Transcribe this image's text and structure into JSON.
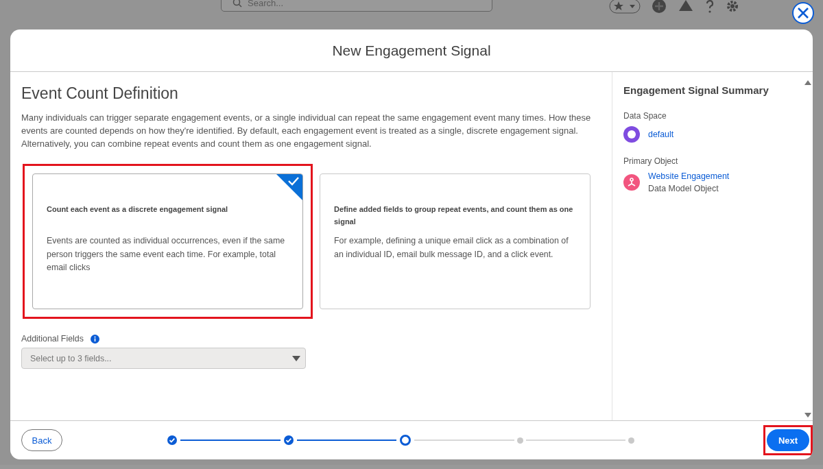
{
  "background": {
    "search": {
      "placeholder": "Search..."
    }
  },
  "dialog": {
    "title": "New Engagement Signal"
  },
  "section": {
    "heading": "Event Count Definition",
    "description": "Many individuals can trigger separate engagement events, or a single individual can repeat the same engagement event many times. How these events are counted depends on how they're identified. By default, each engagement event is treated as a single, discrete engagement signal. Alternatively, you can combine repeat events and count them as one engagement signal."
  },
  "options": [
    {
      "title": "Count each event as a discrete engagement signal",
      "description": "Events are counted as individual occurrences, even if the same person triggers the same event each time. For example, total email clicks",
      "selected": true,
      "highlighted": true
    },
    {
      "title": "Define added fields to group repeat events, and count them as one signal",
      "description": "For example, defining a unique email click as a combination of an individual ID, email bulk message ID, and a click event.",
      "selected": false,
      "highlighted": false
    }
  ],
  "additional_fields": {
    "label": "Additional Fields",
    "placeholder": "Select up to 3 fields..."
  },
  "summary": {
    "title": "Engagement Signal Summary",
    "items": [
      {
        "kind": "data-space",
        "label": "Data Space",
        "value": "default"
      },
      {
        "kind": "object",
        "label": "Primary Object",
        "value": "Website Engagement",
        "subtitle": "Data Model Object"
      }
    ]
  },
  "footer": {
    "back": "Back",
    "next": {
      "label": "Next",
      "highlighted": true
    },
    "steps": [
      {
        "kind": "complete"
      },
      {
        "kind": "complete"
      },
      {
        "kind": "current"
      },
      {
        "kind": "upcoming"
      },
      {
        "kind": "upcoming"
      }
    ]
  }
}
